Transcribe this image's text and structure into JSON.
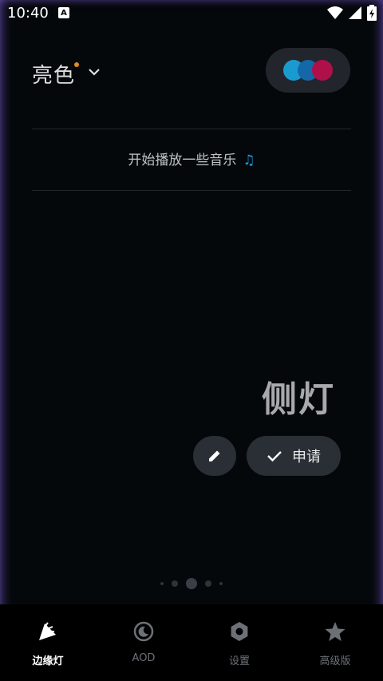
{
  "status_bar": {
    "time": "10:40",
    "notification_badge": "A",
    "icons": [
      "wifi-icon",
      "signal-icon",
      "battery-charging-icon"
    ]
  },
  "header": {
    "theme_name": "亮色",
    "dropdown_icon": "chevron-down-icon",
    "palette_colors": [
      "#1a9bd0",
      "#1468a8",
      "#b0104a"
    ]
  },
  "music_prompt": {
    "text": "开始播放一些音乐",
    "icon": "music-note-icon"
  },
  "preview": {
    "title": "侧灯"
  },
  "actions": {
    "edit_icon": "pencil-icon",
    "apply_icon": "check-icon",
    "apply_label": "申请"
  },
  "pager": {
    "count": 5,
    "active_index": 2
  },
  "bottom_nav": {
    "items": [
      {
        "label": "边缘灯",
        "icon": "edge-light-icon",
        "active": true
      },
      {
        "label": "AOD",
        "icon": "aod-icon",
        "active": false
      },
      {
        "label": "设置",
        "icon": "settings-icon",
        "active": false
      },
      {
        "label": "高级版",
        "icon": "star-icon",
        "active": false
      }
    ]
  },
  "colors": {
    "accent_dot": "#e08a1c",
    "music_note": "#1e9be0",
    "background": "#05080b"
  }
}
